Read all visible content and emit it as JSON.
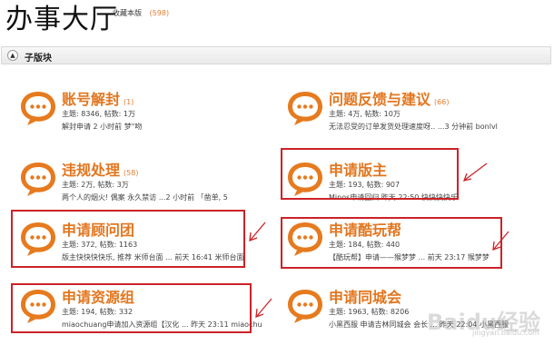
{
  "header": {
    "title": "办事大厅",
    "favorite_label": "收藏本版",
    "favorite_count": "(598)"
  },
  "section": {
    "collapse_symbol": "▲",
    "title": "子版块"
  },
  "boards": [
    {
      "title": "账号解封",
      "count": "(1)",
      "stats": "主题: 8346, 帖数: 1万",
      "last": "解封申请 2 小时前 梦\"吻"
    },
    {
      "title": "问题反馈与建议",
      "count": "(66)",
      "stats": "主题: 4万, 帖数: 10万",
      "last": "无法忍受的订单发货处理速度呀‥ ...3 分钟前 bonlvl"
    },
    {
      "title": "违规处理",
      "count": "(58)",
      "stats": "主题: 2万, 帖数: 3万",
      "last": "两个人的烟火! 偶案 永久禁访 ...2 小时前 「凿单, 5"
    },
    {
      "title": "申请版主",
      "count": "",
      "stats": "主题: 193, 帖数: 907",
      "last": "Minos申请回归 昨天 22:50 快快快快乐"
    },
    {
      "title": "申请顾问团",
      "count": "",
      "stats": "主题: 372, 帖数: 1163",
      "last": "版主快快快快乐, 推荐 米师台面 ... 前天 16:41 米师台面"
    },
    {
      "title": "申请酷玩帮",
      "count": "",
      "stats": "主题: 184, 帖数: 440",
      "last": "【酷玩帮】申请——猴梦梦 ... 前天 23:17 猴梦梦"
    },
    {
      "title": "申请资源组",
      "count": "",
      "stats": "主题: 194, 帖数: 332",
      "last": "miaochuang申请加入资源组【汉化 ... 昨天 23:11 miaochuang"
    },
    {
      "title": "申请同城会",
      "count": "",
      "stats": "主题: 1963, 帖数: 8206",
      "last": "小黑西服 申请吉林同城会 会长 ... 昨天 22:04 小黑西服"
    }
  ],
  "watermark": {
    "text": "Baidu经验",
    "sub": "jingyan.baidu.com"
  },
  "colors": {
    "accent": "#e2761f",
    "highlight": "#cc2229"
  }
}
